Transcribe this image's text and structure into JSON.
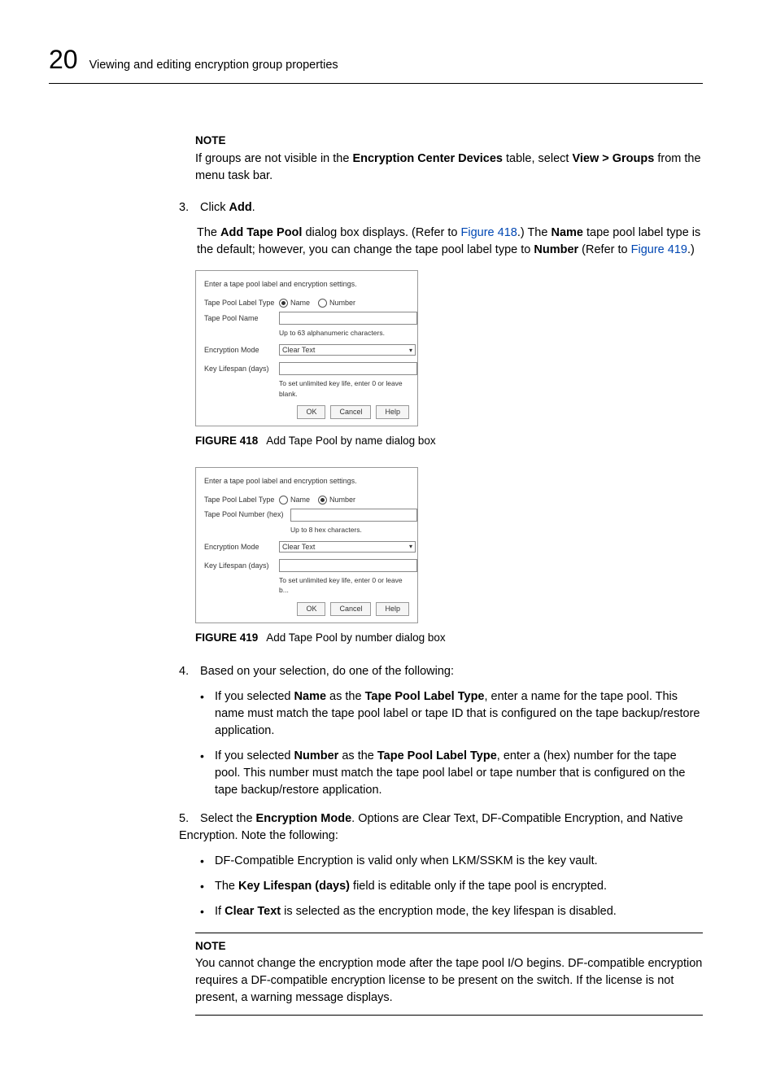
{
  "header": {
    "chapter_number": "20",
    "chapter_title": "Viewing and editing encryption group properties"
  },
  "note1": {
    "heading": "NOTE",
    "text_pre": "If groups are not visible in the ",
    "bold1": "Encryption Center Devices",
    "text_mid": " table, select ",
    "bold2": "View > Groups",
    "text_post": " from the menu task bar."
  },
  "step3": {
    "num": "3.",
    "click": "Click ",
    "add": "Add",
    "dot": ".",
    "p_pre": "The ",
    "p_b1": "Add Tape Pool",
    "p_mid1": " dialog box displays. (Refer to ",
    "p_link1": "Figure 418",
    "p_mid2": ".) The ",
    "p_b2": "Name",
    "p_mid3": " tape pool label type is the default; however, you can change the tape pool label type to ",
    "p_b3": "Number",
    "p_mid4": " (Refer to ",
    "p_link2": "Figure 419",
    "p_end": ".)"
  },
  "dialog1": {
    "intro": "Enter a tape pool label and encryption settings.",
    "label_type": "Tape Pool Label Type",
    "radio_name": "Name",
    "radio_number": "Number",
    "name_label": "Tape Pool Name",
    "name_hint": "Up to 63 alphanumeric characters.",
    "mode_label": "Encryption Mode",
    "mode_value": "Clear Text",
    "life_label": "Key Lifespan (days)",
    "life_hint": "To set unlimited key life, enter 0 or leave blank.",
    "ok": "OK",
    "cancel": "Cancel",
    "help": "Help"
  },
  "fig418": {
    "label": "FIGURE 418",
    "caption": "Add Tape Pool by name dialog box"
  },
  "dialog2": {
    "intro": "Enter a tape pool label and encryption settings.",
    "label_type": "Tape Pool Label Type",
    "radio_name": "Name",
    "radio_number": "Number",
    "num_label": "Tape Pool Number (hex)",
    "num_hint": "Up to 8 hex characters.",
    "mode_label": "Encryption Mode",
    "mode_value": "Clear Text",
    "life_label": "Key Lifespan (days)",
    "life_hint": "To set unlimited key life, enter 0 or leave b...",
    "ok": "OK",
    "cancel": "Cancel",
    "help": "Help"
  },
  "fig419": {
    "label": "FIGURE 419",
    "caption": "Add Tape Pool by number dialog box"
  },
  "step4": {
    "num": "4.",
    "text": "Based on your selection, do one of the following:",
    "b1_pre": "If you selected ",
    "b1_b1": "Name",
    "b1_mid": " as the ",
    "b1_b2": "Tape Pool Label Type",
    "b1_post": ", enter a name for the tape pool. This name must match the tape pool label or tape ID that is configured on the tape backup/restore application.",
    "b2_pre": "If you selected ",
    "b2_b1": "Number",
    "b2_mid": " as the ",
    "b2_b2": "Tape Pool Label Type",
    "b2_post": ", enter a (hex) number for the tape pool. This number must match the tape pool label or tape number that is configured on the tape backup/restore application."
  },
  "step5": {
    "num": "5.",
    "pre": "Select the ",
    "b1": "Encryption Mode",
    "post": ". Options are Clear Text, DF-Compatible Encryption, and Native Encryption. Note the following:",
    "bul1": "DF-Compatible Encryption is valid only when LKM/SSKM is the key vault.",
    "bul2_pre": "The ",
    "bul2_b": "Key Lifespan (days)",
    "bul2_post": " field is editable only if the tape pool is encrypted.",
    "bul3_pre": "If ",
    "bul3_b": "Clear Text",
    "bul3_post": " is selected as the encryption mode, the key lifespan is disabled."
  },
  "note2": {
    "heading": "NOTE",
    "text": "You cannot change the encryption mode after the tape pool I/O begins. DF-compatible encryption requires a DF-compatible encryption license to be present on the switch. If the license is not present, a warning message displays."
  }
}
